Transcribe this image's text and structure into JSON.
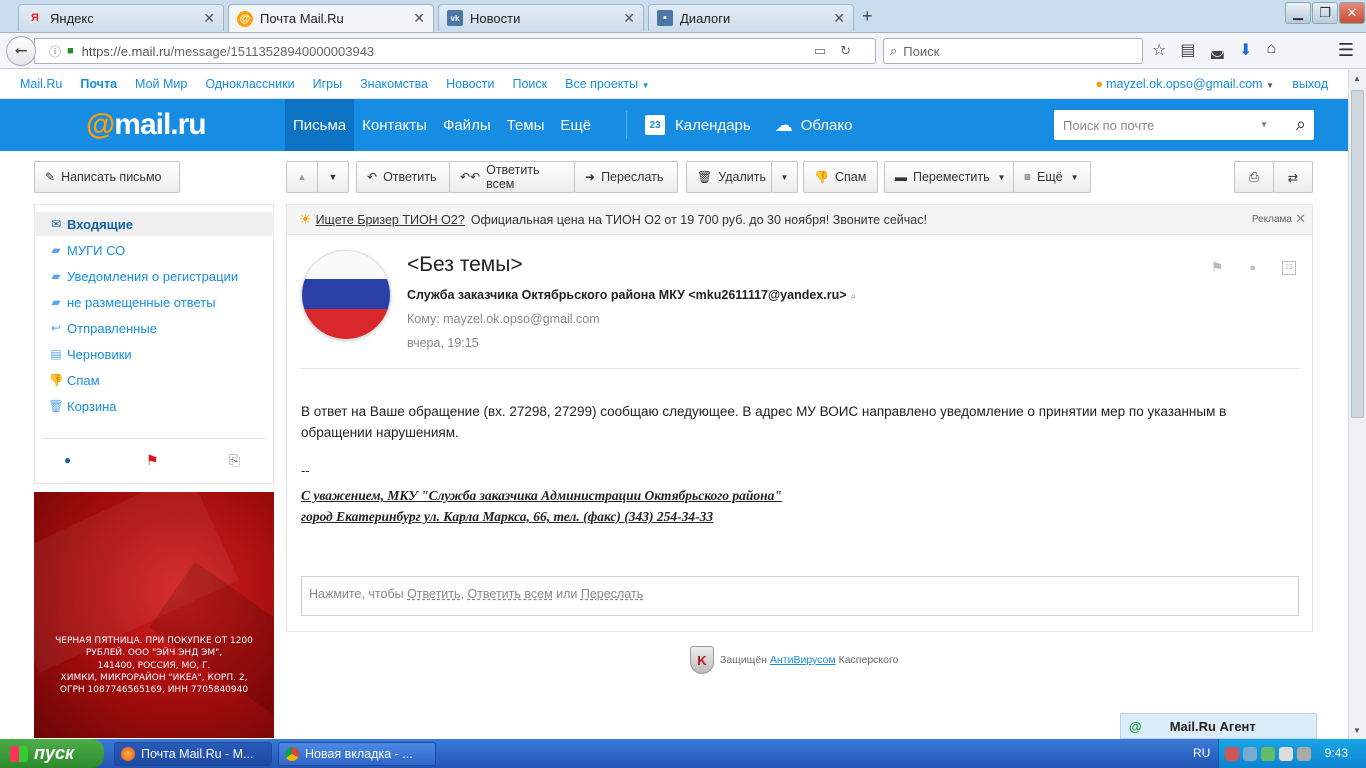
{
  "browser": {
    "tabs": [
      {
        "label": "Яндекс",
        "icon": "yandex-icon"
      },
      {
        "label": "Почта Mail.Ru",
        "icon": "mailru-icon"
      },
      {
        "label": "Новости",
        "icon": "vk-icon"
      },
      {
        "label": "Диалоги",
        "icon": "chat-icon"
      }
    ],
    "url_host": "https://e.mail.ru",
    "url_path": "/message/15113528940000003943",
    "search_placeholder": "Поиск"
  },
  "portal": {
    "links": [
      "Mail.Ru",
      "Почта",
      "Мой Мир",
      "Одноклассники",
      "Игры",
      "Знакомства",
      "Новости",
      "Поиск",
      "Все проекты"
    ],
    "user": "mayzel.ok.opso@gmail.com",
    "exit": "выход"
  },
  "header": {
    "logo": "mail.ru",
    "nav": [
      "Письма",
      "Контакты",
      "Файлы",
      "Темы",
      "Ещё"
    ],
    "calendar": "Календарь",
    "calendar_day": "23",
    "cloud": "Облако",
    "search_placeholder": "Поиск по почте"
  },
  "toolbar": {
    "compose": "Написать письмо",
    "reply": "Ответить",
    "reply_all": "Ответить всем",
    "forward": "Переслать",
    "delete": "Удалить",
    "spam": "Спам",
    "move": "Переместить",
    "more": "Ещё"
  },
  "folders": [
    {
      "label": "Входящие",
      "icon": "inbox-icon"
    },
    {
      "label": "МУГИ СО",
      "icon": "folder-icon"
    },
    {
      "label": "Уведомления о регистрации",
      "icon": "folder-icon"
    },
    {
      "label": "не размещенные ответы",
      "icon": "folder-icon"
    },
    {
      "label": "Отправленные",
      "icon": "sent-icon"
    },
    {
      "label": "Черновики",
      "icon": "drafts-icon"
    },
    {
      "label": "Спам",
      "icon": "spam-icon"
    },
    {
      "label": "Корзина",
      "icon": "trash-icon"
    }
  ],
  "sidebar_ad": {
    "lines": [
      "ЧЕРНАЯ ПЯТНИЦА. ПРИ ПОКУПКЕ ОТ 1200",
      "РУБЛЕЙ. ООО \"ЭЙЧ ЭНД ЭМ\",",
      "141400, РОССИЯ, МО, Г.",
      "ХИМКИ, МИКРОРАЙОН \"ИКЕА\", КОРП. 2,",
      "ОГРН 1087746565169, ИНН 7705840940"
    ]
  },
  "ad_banner": {
    "link": "Ищете Бризер ТИОН О2?",
    "text": "Официальная цена на ТИОН О2 от 19 700 руб. до 30 ноября! Звоните сейчас!",
    "label": "Реклама"
  },
  "message": {
    "subject": "<Без темы>",
    "from": "Служба заказчика Октябрьского района МКУ <mku2611117@yandex.ru>",
    "to": "Кому: mayzel.ok.opso@gmail.com",
    "date": "вчера, 19:15",
    "calendar_day": "23",
    "body": "В ответ на Ваше обращение (вх. 27298, 27299) сообщаю следующее. В адрес МУ ВОИС направлено уведомление о принятии мер по указанным в обращении нарушениям.",
    "dash": "--",
    "signature_1": "С уважением, МКУ \"Служба заказчика Администрации Октябрьского района\"",
    "signature_2": "город Екатеринбург ул. Карла Маркса, 66, тел. (факс) (343) 254-34-33",
    "reply_prefix": "Нажмите, чтобы",
    "reply_link": "Ответить",
    "reply_all_link": "Ответить всем",
    "reply_or": "или",
    "forward_link": "Переслать"
  },
  "kaspersky": {
    "prefix": "Защищён",
    "link": "АнтиВирусом",
    "suffix": "Касперского"
  },
  "agent": "Mail.Ru Агент",
  "taskbar": {
    "start": "пуск",
    "tasks": [
      "Почта Mail.Ru - М...",
      "Новая вкладка - ..."
    ],
    "lang": "RU",
    "time": "9:43"
  }
}
